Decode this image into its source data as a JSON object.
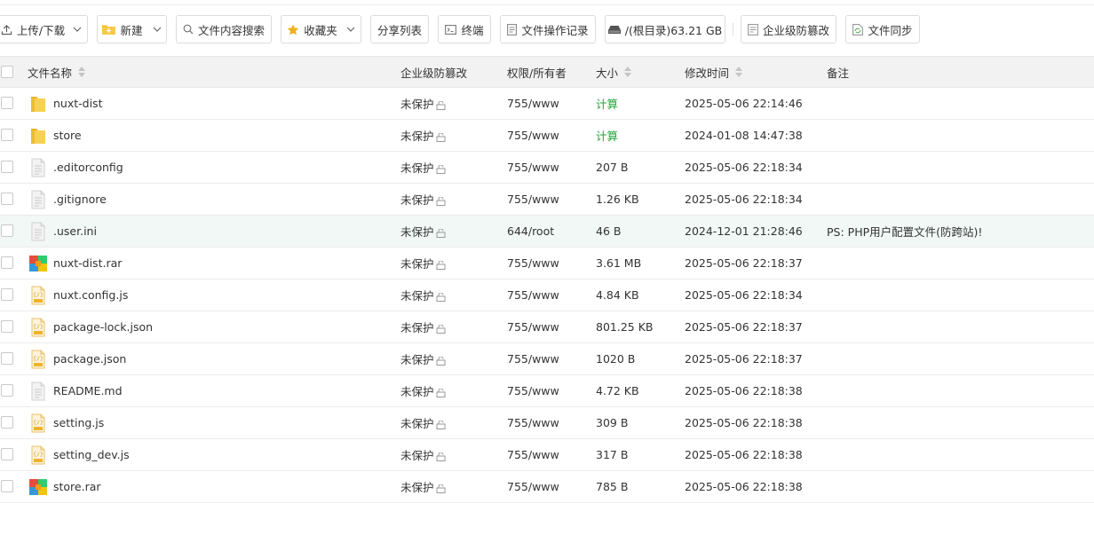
{
  "toolbar": {
    "upload_download": "上传/下载",
    "new": "新建",
    "content_search": "文件内容搜索",
    "favorites": "收藏夹",
    "share_list": "分享列表",
    "terminal": "终端",
    "operation_log": "文件操作记录",
    "disk": "/(根目录)63.21 GB",
    "tamper_proof": "企业级防篡改",
    "file_sync": "文件同步"
  },
  "table": {
    "headers": {
      "name": "文件名称",
      "tamper": "企业级防篡改",
      "permission": "权限/所有者",
      "size": "大小",
      "mtime": "修改时间",
      "note": "备注"
    },
    "rows": [
      {
        "icon": "folder-icon",
        "name": "nuxt-dist",
        "tamper": "未保护",
        "perm": "755/www",
        "size": "计算",
        "size_is_link": true,
        "mtime": "2025-05-06 22:14:46",
        "note": ""
      },
      {
        "icon": "folder-icon",
        "name": "store",
        "tamper": "未保护",
        "perm": "755/www",
        "size": "计算",
        "size_is_link": true,
        "mtime": "2024-01-08 14:47:38",
        "note": ""
      },
      {
        "icon": "text-file-icon",
        "name": ".editorconfig",
        "tamper": "未保护",
        "perm": "755/www",
        "size": "207 B",
        "size_is_link": false,
        "mtime": "2025-05-06 22:18:34",
        "note": ""
      },
      {
        "icon": "text-file-icon",
        "name": ".gitignore",
        "tamper": "未保护",
        "perm": "755/www",
        "size": "1.26 KB",
        "size_is_link": false,
        "mtime": "2025-05-06 22:18:34",
        "note": ""
      },
      {
        "icon": "text-file-icon",
        "name": ".user.ini",
        "tamper": "未保护",
        "perm": "644/root",
        "size": "46 B",
        "size_is_link": false,
        "mtime": "2024-12-01 21:28:46",
        "note": "PS: PHP用户配置文件(防跨站)!",
        "highlight": true
      },
      {
        "icon": "archive-icon",
        "name": "nuxt-dist.rar",
        "tamper": "未保护",
        "perm": "755/www",
        "size": "3.61 MB",
        "size_is_link": false,
        "mtime": "2025-05-06 22:18:37",
        "note": ""
      },
      {
        "icon": "code-file-icon",
        "name": "nuxt.config.js",
        "tamper": "未保护",
        "perm": "755/www",
        "size": "4.84 KB",
        "size_is_link": false,
        "mtime": "2025-05-06 22:18:34",
        "note": ""
      },
      {
        "icon": "code-file-icon",
        "name": "package-lock.json",
        "tamper": "未保护",
        "perm": "755/www",
        "size": "801.25 KB",
        "size_is_link": false,
        "mtime": "2025-05-06 22:18:37",
        "note": ""
      },
      {
        "icon": "code-file-icon",
        "name": "package.json",
        "tamper": "未保护",
        "perm": "755/www",
        "size": "1020 B",
        "size_is_link": false,
        "mtime": "2025-05-06 22:18:37",
        "note": ""
      },
      {
        "icon": "text-file-icon",
        "name": "README.md",
        "tamper": "未保护",
        "perm": "755/www",
        "size": "4.72 KB",
        "size_is_link": false,
        "mtime": "2025-05-06 22:18:38",
        "note": ""
      },
      {
        "icon": "code-file-icon",
        "name": "setting.js",
        "tamper": "未保护",
        "perm": "755/www",
        "size": "309 B",
        "size_is_link": false,
        "mtime": "2025-05-06 22:18:38",
        "note": ""
      },
      {
        "icon": "code-file-icon",
        "name": "setting_dev.js",
        "tamper": "未保护",
        "perm": "755/www",
        "size": "317 B",
        "size_is_link": false,
        "mtime": "2025-05-06 22:18:38",
        "note": ""
      },
      {
        "icon": "archive-icon",
        "name": "store.rar",
        "tamper": "未保护",
        "perm": "755/www",
        "size": "785 B",
        "size_is_link": false,
        "mtime": "2025-05-06 22:18:38",
        "note": ""
      }
    ]
  },
  "colors": {
    "accent_green": "#20a53a",
    "header_bg": "#f2f2f2",
    "highlight_row": "#f1f8f5",
    "folder_yellow": "#f5c842"
  }
}
